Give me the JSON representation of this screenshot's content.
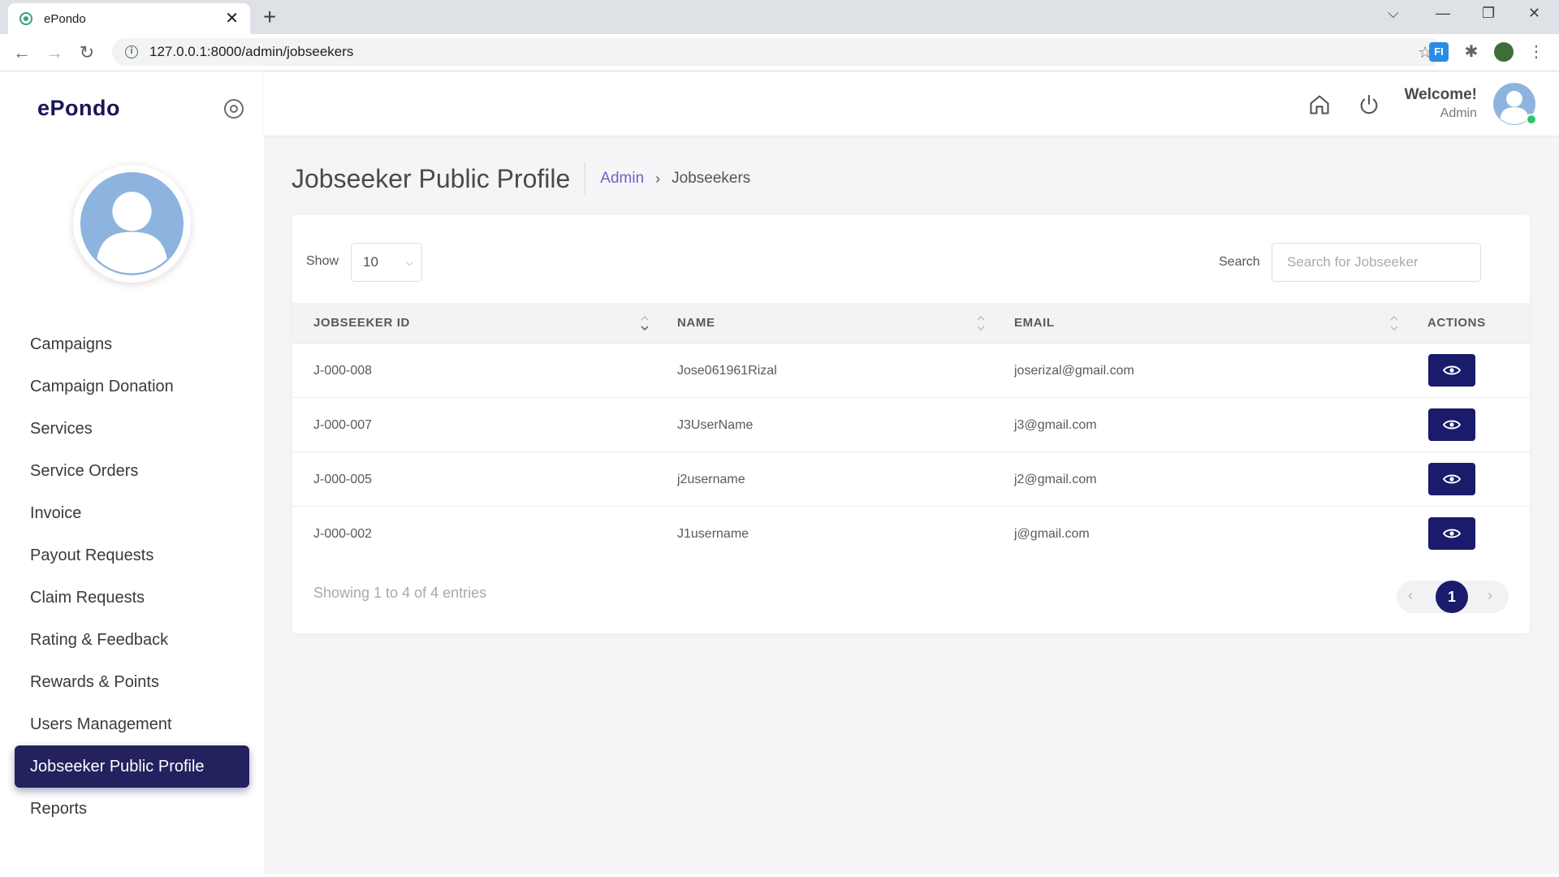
{
  "browser": {
    "tab_title": "ePondo",
    "tab_close": "✕",
    "new_tab": "+",
    "url": "127.0.0.1:8000/admin/jobseekers",
    "ext_label": "FI"
  },
  "sidebar": {
    "brand": "ePondo",
    "items": [
      {
        "label": "Campaigns"
      },
      {
        "label": "Campaign Donation"
      },
      {
        "label": "Services"
      },
      {
        "label": "Service Orders"
      },
      {
        "label": "Invoice"
      },
      {
        "label": "Payout Requests"
      },
      {
        "label": "Claim Requests"
      },
      {
        "label": "Rating & Feedback"
      },
      {
        "label": "Rewards & Points"
      },
      {
        "label": "Users Management"
      },
      {
        "label": "Jobseeker Public Profile"
      },
      {
        "label": "Reports"
      }
    ],
    "active_item": "Jobseeker Public Profile"
  },
  "topbar": {
    "welcome": "Welcome!",
    "user_role": "Admin"
  },
  "page": {
    "title": "Jobseeker Public Profile",
    "breadcrumb_root": "Admin",
    "breadcrumb_sep": "›",
    "breadcrumb_current": "Jobseekers"
  },
  "table_controls": {
    "show_label": "Show",
    "show_value": "10",
    "search_label": "Search",
    "search_placeholder": "Search for Jobseeker"
  },
  "table": {
    "columns": [
      "JOBSEEKER ID",
      "NAME",
      "EMAIL",
      "ACTIONS"
    ],
    "rows": [
      {
        "id": "J-000-008",
        "name": "Jose061961Rizal",
        "email": "joserizal@gmail.com"
      },
      {
        "id": "J-000-007",
        "name": "J3UserName",
        "email": "j3@gmail.com"
      },
      {
        "id": "J-000-005",
        "name": "j2username",
        "email": "j2@gmail.com"
      },
      {
        "id": "J-000-002",
        "name": "J1username",
        "email": "j@gmail.com"
      }
    ]
  },
  "footer": {
    "info": "Showing 1 to 4 of 4 entries",
    "prev": "‹",
    "current_page": "1",
    "next": "›"
  },
  "colors": {
    "primary": "#1b1b6b",
    "sidebar_active": "#24215f",
    "breadcrumb_link": "#6f64c8",
    "online": "#28c76f"
  }
}
